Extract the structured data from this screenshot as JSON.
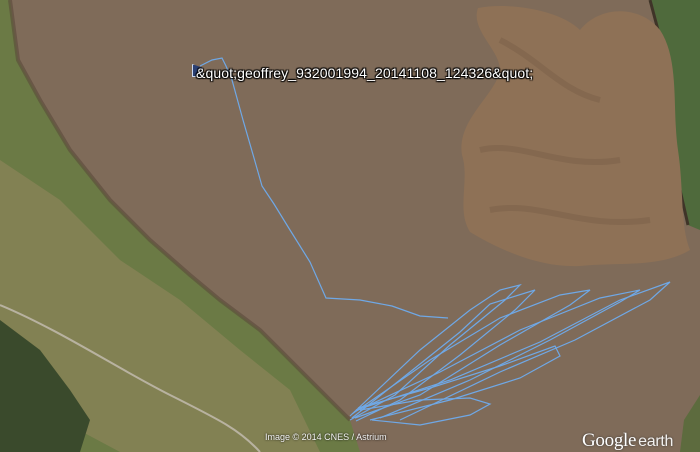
{
  "track": {
    "name": "&quot;geoffrey_932001994_20141108_124326&quot;",
    "color": "#6fa8e6"
  },
  "map": {
    "water_color": "#7d6a58",
    "land_color": "#6f7d45",
    "marsh_color": "#8e7156"
  },
  "attribution": {
    "imagery": "Image © 2014 CNES / Astrium",
    "logo_main": "Google",
    "logo_sub": "earth"
  },
  "icons": {
    "start": "track-start-flag-icon"
  }
}
